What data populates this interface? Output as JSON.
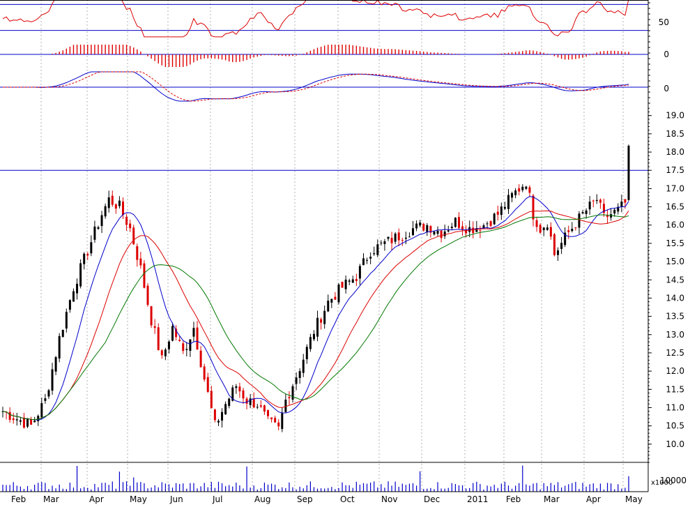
{
  "chart_data": {
    "type": "candlestick",
    "x_months": [
      "Feb",
      "Mar",
      "Apr",
      "May",
      "Jun",
      "Jul",
      "Aug",
      "Sep",
      "Oct",
      "Nov",
      "Dec",
      "2011",
      "Feb",
      "Mar",
      "Apr",
      "May"
    ],
    "price_axis": {
      "ylim": [
        9.5,
        19.3
      ],
      "ticks": [
        "19.0",
        "18.5",
        "18.0",
        "17.5",
        "17.0",
        "16.5",
        "16.0",
        "15.5",
        "15.0",
        "14.5",
        "14.0",
        "13.5",
        "13.0",
        "12.5",
        "12.0",
        "11.5",
        "11.0",
        "10.5",
        "10.0"
      ],
      "horizontal_line": 17.5
    },
    "price_anchors": [
      [
        0,
        10.9
      ],
      [
        8,
        10.5
      ],
      [
        12,
        11.2
      ],
      [
        16,
        12.9
      ],
      [
        20,
        14.3
      ],
      [
        24,
        15.3
      ],
      [
        28,
        16.3
      ],
      [
        30,
        16.7
      ],
      [
        33,
        16.5
      ],
      [
        36,
        15.9
      ],
      [
        39,
        14.8
      ],
      [
        42,
        13.4
      ],
      [
        45,
        12.3
      ],
      [
        48,
        13.2
      ],
      [
        51,
        12.5
      ],
      [
        54,
        13.2
      ],
      [
        57,
        11.8
      ],
      [
        60,
        10.5
      ],
      [
        63,
        11.1
      ],
      [
        66,
        11.6
      ],
      [
        69,
        11.2
      ],
      [
        72,
        11.1
      ],
      [
        75,
        10.6
      ],
      [
        78,
        10.4
      ],
      [
        80,
        11.2
      ],
      [
        84,
        12.1
      ],
      [
        88,
        13.1
      ],
      [
        92,
        13.9
      ],
      [
        96,
        14.3
      ],
      [
        100,
        14.6
      ],
      [
        104,
        15.3
      ],
      [
        108,
        15.5
      ],
      [
        112,
        15.7
      ],
      [
        116,
        15.9
      ],
      [
        120,
        16.0
      ],
      [
        124,
        15.8
      ],
      [
        128,
        16.1
      ],
      [
        132,
        15.9
      ],
      [
        136,
        16.0
      ],
      [
        140,
        16.3
      ],
      [
        144,
        16.8
      ],
      [
        148,
        17.2
      ],
      [
        150,
        16.3
      ],
      [
        152,
        15.9
      ],
      [
        154,
        16.1
      ],
      [
        156,
        15.2
      ],
      [
        158,
        15.5
      ],
      [
        160,
        15.8
      ],
      [
        164,
        16.3
      ],
      [
        168,
        16.7
      ],
      [
        170,
        16.2
      ],
      [
        174,
        16.4
      ],
      [
        176,
        16.6
      ],
      [
        177,
        18.0
      ]
    ],
    "bar_count": 178,
    "moving_averages": [
      {
        "color": "#0000cc",
        "period": 10
      },
      {
        "color": "#dd0000",
        "period": 20
      },
      {
        "color": "#007700",
        "period": 30
      }
    ],
    "indicators": [
      {
        "type": "line",
        "tick_label": "50",
        "reference_lines": [
          0.2,
          0.8
        ],
        "color": "#dd0000"
      },
      {
        "type": "histogram",
        "tick_label": "0",
        "color": "#dd0000"
      },
      {
        "type": "macd",
        "tick_label": "0",
        "colors": [
          "#0000cc",
          "#dd0000"
        ]
      }
    ],
    "volume": {
      "unit_label": "x1000",
      "tick_label": "10000",
      "spike_bars": [
        21,
        33,
        37,
        69,
        118,
        147,
        177
      ]
    },
    "colors": {
      "up": "#000000",
      "down": "#dd0000",
      "grid": "#b0b0b0",
      "frame": "#000000",
      "reference_line": "#0000cc"
    },
    "grid": true
  }
}
